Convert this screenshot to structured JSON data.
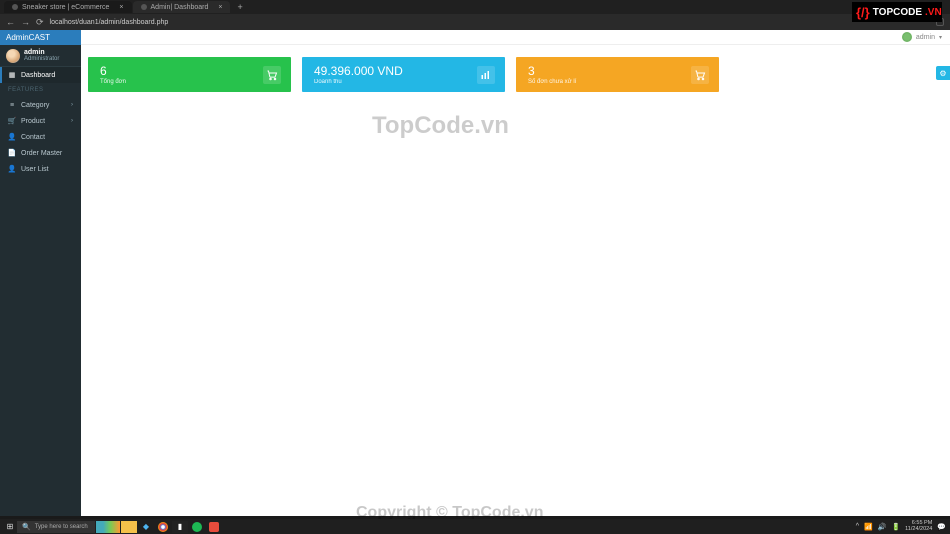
{
  "browser": {
    "tabs": [
      {
        "title": "Sneaker store | eCommerce"
      },
      {
        "title": "Admin| Dashboard"
      }
    ],
    "url": "localhost/duan1/admin/dashboard.php"
  },
  "header": {
    "brand": "AdminCAST",
    "user": "admin"
  },
  "sidebar": {
    "user": {
      "name": "admin",
      "role": "Administrator"
    },
    "dashboard": "Dashboard",
    "features_label": "FEATURES",
    "items": {
      "category": "Category",
      "product": "Product",
      "contact": "Contact",
      "order": "Order Master",
      "userlist": "User List"
    }
  },
  "cards": {
    "c1": {
      "value": "6",
      "label": "Tổng đơn"
    },
    "c2": {
      "value": "49.396.000 VND",
      "label": "Doanh thu"
    },
    "c3": {
      "value": "3",
      "label": "Số đơn chưa xử lí"
    },
    "color_green": "#27c24c",
    "color_blue": "#23b7e5",
    "color_orange": "#f5a623"
  },
  "watermarks": {
    "top": "TopCode.vn",
    "bottom": "Copyright © TopCode.vn"
  },
  "overlay": {
    "logo_top": "TOPCODE",
    "logo_vn": ".VN"
  },
  "taskbar": {
    "search_placeholder": "Type here to search",
    "time": "6:55 PM",
    "date": "11/24/2024"
  }
}
